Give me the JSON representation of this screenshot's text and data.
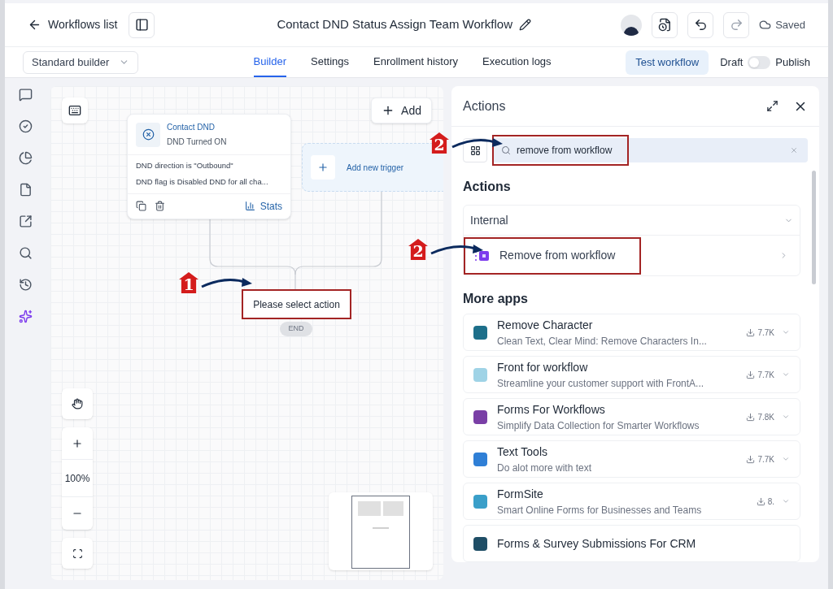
{
  "header": {
    "back_label": "Workflows list",
    "title": "Contact DND Status Assign Team Workflow",
    "save_status": "Saved"
  },
  "builder_select": {
    "value": "Standard builder"
  },
  "tabs": [
    {
      "label": "Builder",
      "selected": true
    },
    {
      "label": "Settings",
      "selected": false
    },
    {
      "label": "Enrollment history",
      "selected": false
    },
    {
      "label": "Execution logs",
      "selected": false
    }
  ],
  "test_button": "Test workflow",
  "publish_toggle": {
    "off_label": "Draft",
    "on_label": "Publish",
    "on": false
  },
  "canvas": {
    "add_button": "Add",
    "trigger": {
      "title": "Contact DND",
      "subtitle": "DND Turned ON",
      "conditions": [
        "DND direction is \"Outbound\"",
        "DND flag is Disabled DND for all cha..."
      ],
      "stats_label": "Stats"
    },
    "add_trigger": "Add new trigger",
    "action_node": {
      "label": "Please select action",
      "highlighted": true
    },
    "end_label": "END",
    "zoom": "100%"
  },
  "panel": {
    "title": "Actions",
    "search": {
      "value": "remove from workflow",
      "highlighted": true
    },
    "actions_heading": "Actions",
    "group": {
      "label": "Internal",
      "expanded": true,
      "items": [
        {
          "label": "Remove from workflow",
          "highlighted": true
        }
      ]
    },
    "more_heading": "More apps",
    "apps": [
      {
        "name": "Remove Character",
        "description": "Clean Text, Clear Mind: Remove Characters In...",
        "downloads": "7.7K",
        "color": "#1d6f8a"
      },
      {
        "name": "Front for workflow",
        "description": "Streamline your customer support with FrontA...",
        "downloads": "7.7K",
        "color": "#9fd3e6"
      },
      {
        "name": "Forms For Workflows",
        "description": "Simplify Data Collection for Smarter Workflows",
        "downloads": "7.8K",
        "color": "#7a3fa6"
      },
      {
        "name": "Text Tools",
        "description": "Do alot more with text",
        "downloads": "7.7K",
        "color": "#2f7fd6"
      },
      {
        "name": "FormSite",
        "description": "Smart Online Forms for Businesses and Teams",
        "downloads": "8.",
        "color": "#3a9fc9"
      },
      {
        "name": "Forms & Survey Submissions For CRM",
        "color": "#1f4e66"
      }
    ]
  },
  "annotations": [
    {
      "label": "1"
    },
    {
      "label": "2"
    },
    {
      "label": "2"
    }
  ]
}
